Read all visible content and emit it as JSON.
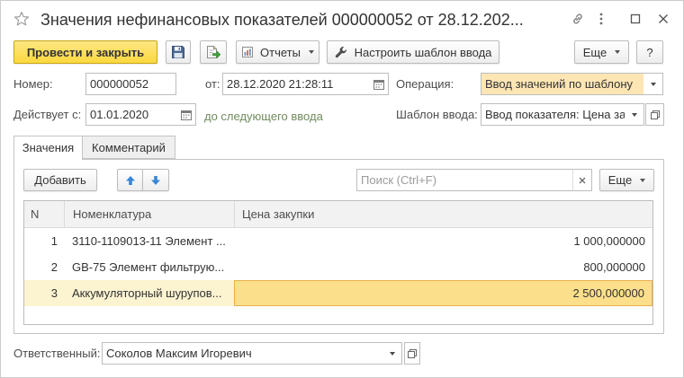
{
  "window": {
    "title": "Значения нефинансовых показателей 000000052 от 28.12.202...",
    "favorite_icon": "star-icon",
    "link_icon": "link-icon",
    "more_icon": "more-vertical-icon",
    "maximize_icon": "maximize-icon",
    "close_icon": "close-icon"
  },
  "toolbar": {
    "post_and_close_label": "Провести и закрыть",
    "save_icon": "save-icon",
    "post_icon": "post-document-icon",
    "reports_label": "Отчеты",
    "reports_icon": "reports-icon",
    "template_settings_label": "Настроить шаблон ввода",
    "template_settings_icon": "wrench-icon",
    "more_label": "Еще",
    "help_label": "?"
  },
  "form": {
    "number": {
      "label": "Номер:",
      "value": "000000052"
    },
    "date": {
      "label": "от:",
      "value": "28.12.2020 21:28:11",
      "icon": "calendar-icon"
    },
    "operation": {
      "label": "Операция:",
      "value": "Ввод значений по шаблону"
    },
    "valid_from": {
      "label": "Действует с:",
      "value": "01.01.2020",
      "hint": "до следующего ввода",
      "icon": "calendar-icon"
    },
    "template": {
      "label": "Шаблон ввода:",
      "value": "Ввод показателя: Цена за",
      "open_icon": "open-icon"
    }
  },
  "tabs": [
    {
      "label": "Значения",
      "active": true
    },
    {
      "label": "Комментарий",
      "active": false
    }
  ],
  "values_panel": {
    "add_label": "Добавить",
    "move_up_icon": "arrow-up-icon",
    "move_down_icon": "arrow-down-icon",
    "search_placeholder": "Поиск (Ctrl+F)",
    "search_clear_icon": "clear-icon",
    "more_label": "Еще",
    "table": {
      "columns": [
        "N",
        "Номенклатура",
        "Цена закупки"
      ],
      "rows": [
        {
          "n": "1",
          "item": "3110-1109013-11 Элемент ...",
          "price": "1 000,000000",
          "selected": false
        },
        {
          "n": "2",
          "item": "GB-75 Элемент фильтрую...",
          "price": "800,000000",
          "selected": false
        },
        {
          "n": "3",
          "item": "Аккумуляторный шурупов...",
          "price": "2 500,000000",
          "selected": true
        }
      ]
    }
  },
  "footer": {
    "responsible": {
      "label": "Ответственный:",
      "value": "Соколов Максим Игоревич",
      "open_icon": "open-icon"
    }
  },
  "colors": {
    "default_button": "#fbd93f",
    "operation_field": "#fde6b4",
    "hint_text": "#718c5e",
    "selected_row": "#fcf3d1",
    "selected_cell": "#fbdf8a",
    "selected_cell_border": "#e9b04b",
    "arrow_blue": "#3a87d6"
  }
}
